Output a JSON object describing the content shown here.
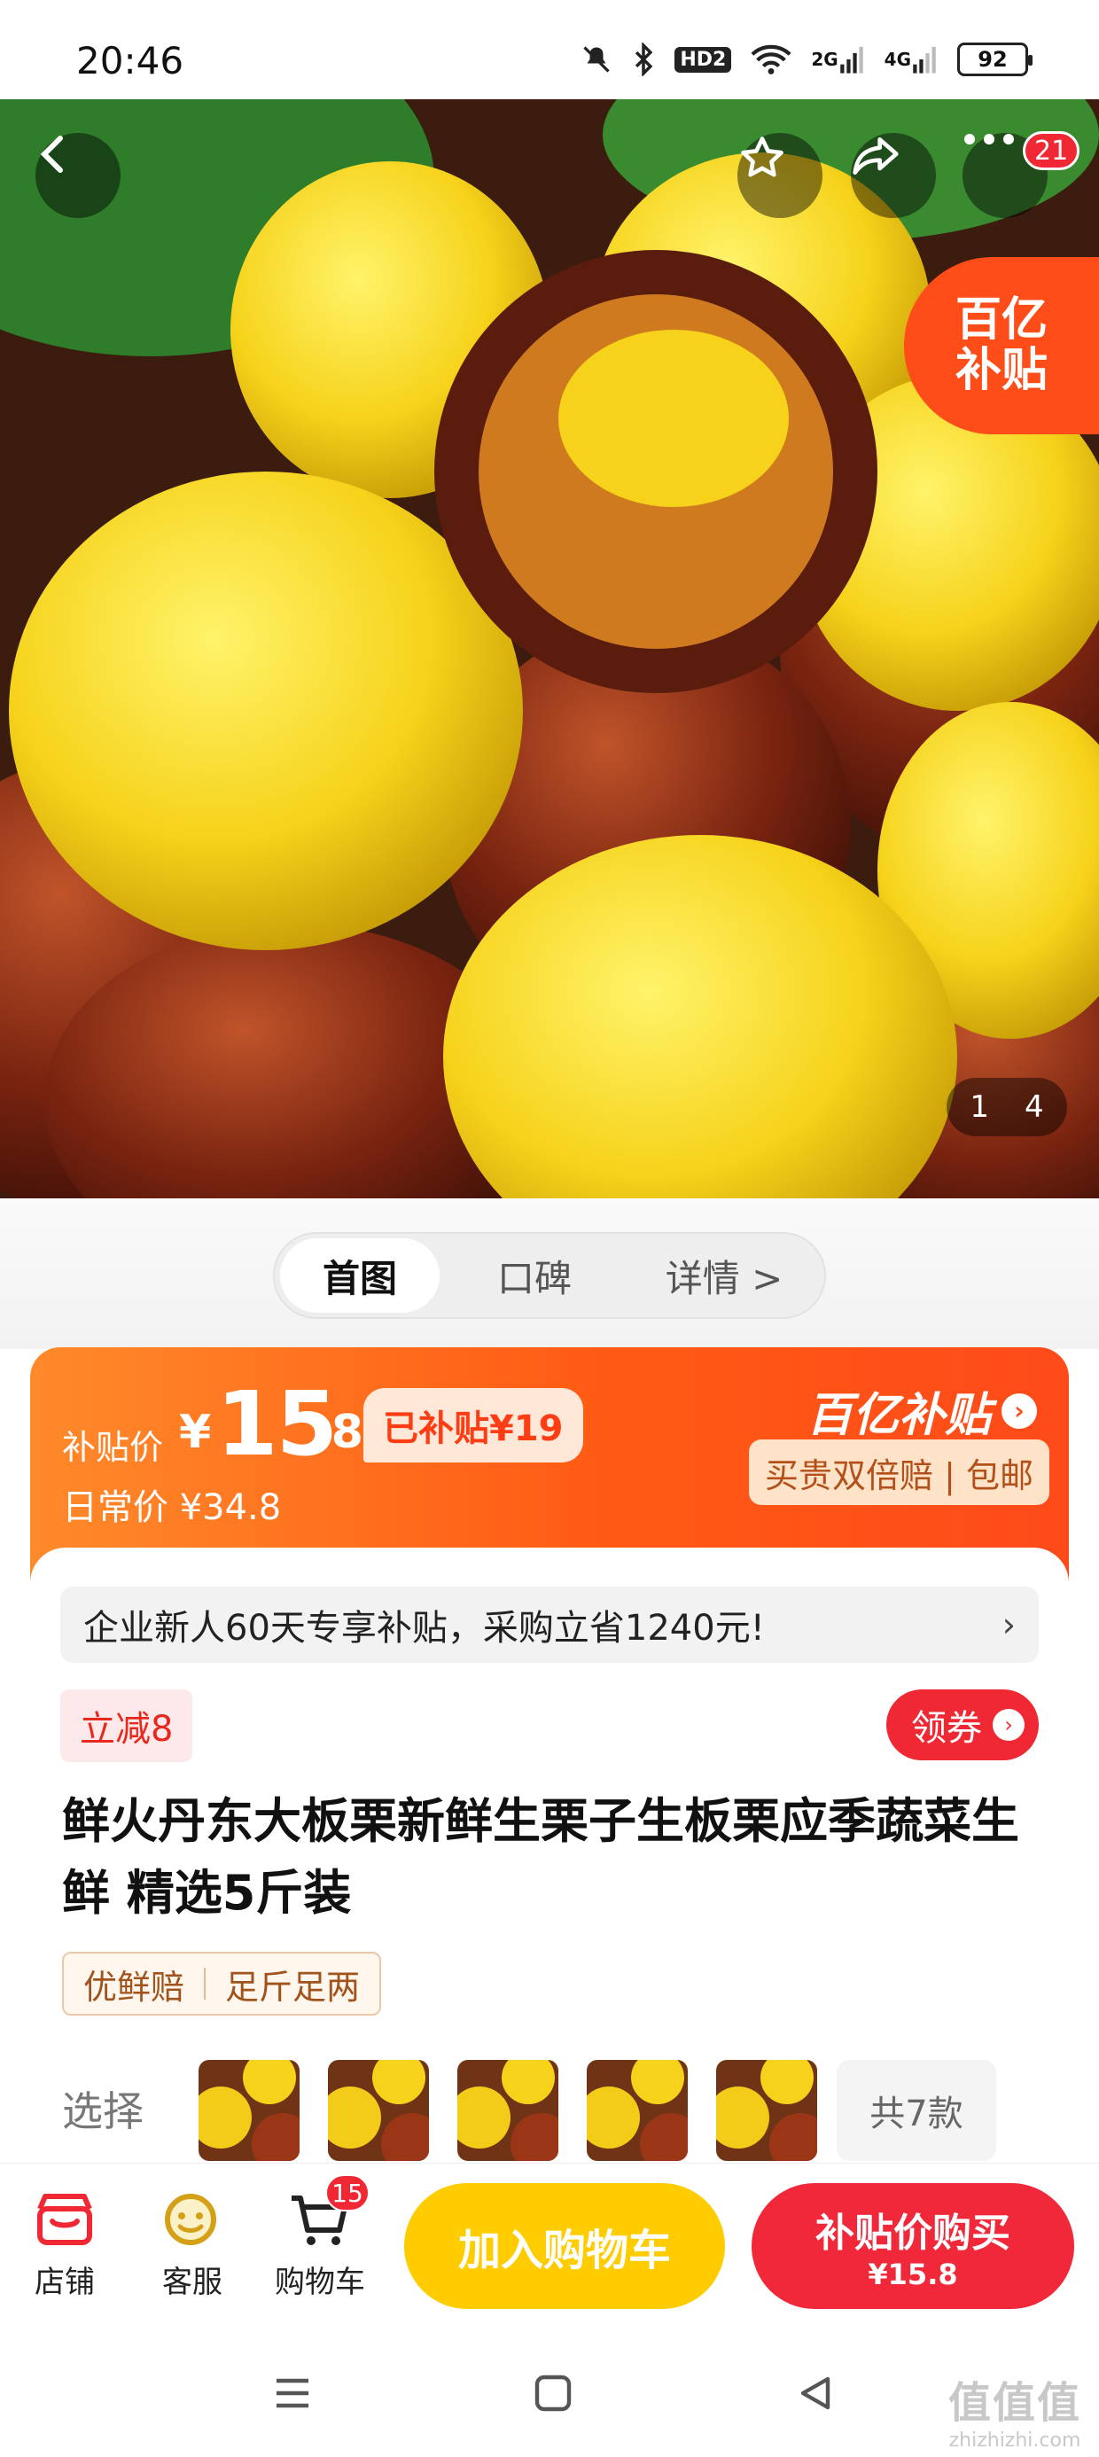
{
  "status_bar": {
    "time": "20:46",
    "icons": [
      "mute-icon",
      "bluetooth-icon",
      "hd-icon",
      "wifi-icon",
      "signal-2g-icon",
      "signal-4g-icon"
    ],
    "hd_label": "HD2",
    "net1": "2G",
    "net2": "4G",
    "battery": "92"
  },
  "hero": {
    "more_badge": "21",
    "subsidy_line1": "百亿",
    "subsidy_line2": "补贴",
    "image_index": "1",
    "image_total": "4"
  },
  "section_tabs": [
    {
      "label": "首图",
      "active": true
    },
    {
      "label": "口碑",
      "active": false
    },
    {
      "label": "详情 >",
      "active": false
    }
  ],
  "price": {
    "label": "补贴价",
    "currency": "¥",
    "integer": "15",
    "decimal": ".8",
    "subsidized": "已补贴¥19",
    "daily_label": "日常价 ¥34.8",
    "brand": "百亿补贴",
    "guarantee": "买贵双倍赔 | 包邮",
    "colors": {
      "band_start": "#ff8a2a",
      "band_end": "#ff4a1a",
      "accent_red": "#f02833",
      "cart_yellow": "#ffcc00"
    }
  },
  "promo": {
    "text": "企业新人60天专享补贴，采购立省1240元!",
    "arrow": "›"
  },
  "reduce_tag": "立减8",
  "coupon_button": "领券",
  "product_title": "鲜火丹东大板栗新鲜生栗子生板栗应季蔬菜生鲜 精选5斤装",
  "service_tags": [
    "优鲜赔",
    "足斤足两"
  ],
  "select": {
    "label": "选择",
    "more": "共7款"
  },
  "action_bar": {
    "shop": "店铺",
    "service": "客服",
    "cart": "购物车",
    "cart_count": "15",
    "add_to_cart": "加入购物车",
    "buy_label": "补贴价购买",
    "buy_price": "¥15.8"
  },
  "watermark": {
    "line1": "值值值",
    "line2": "zhizhizhi.com"
  }
}
